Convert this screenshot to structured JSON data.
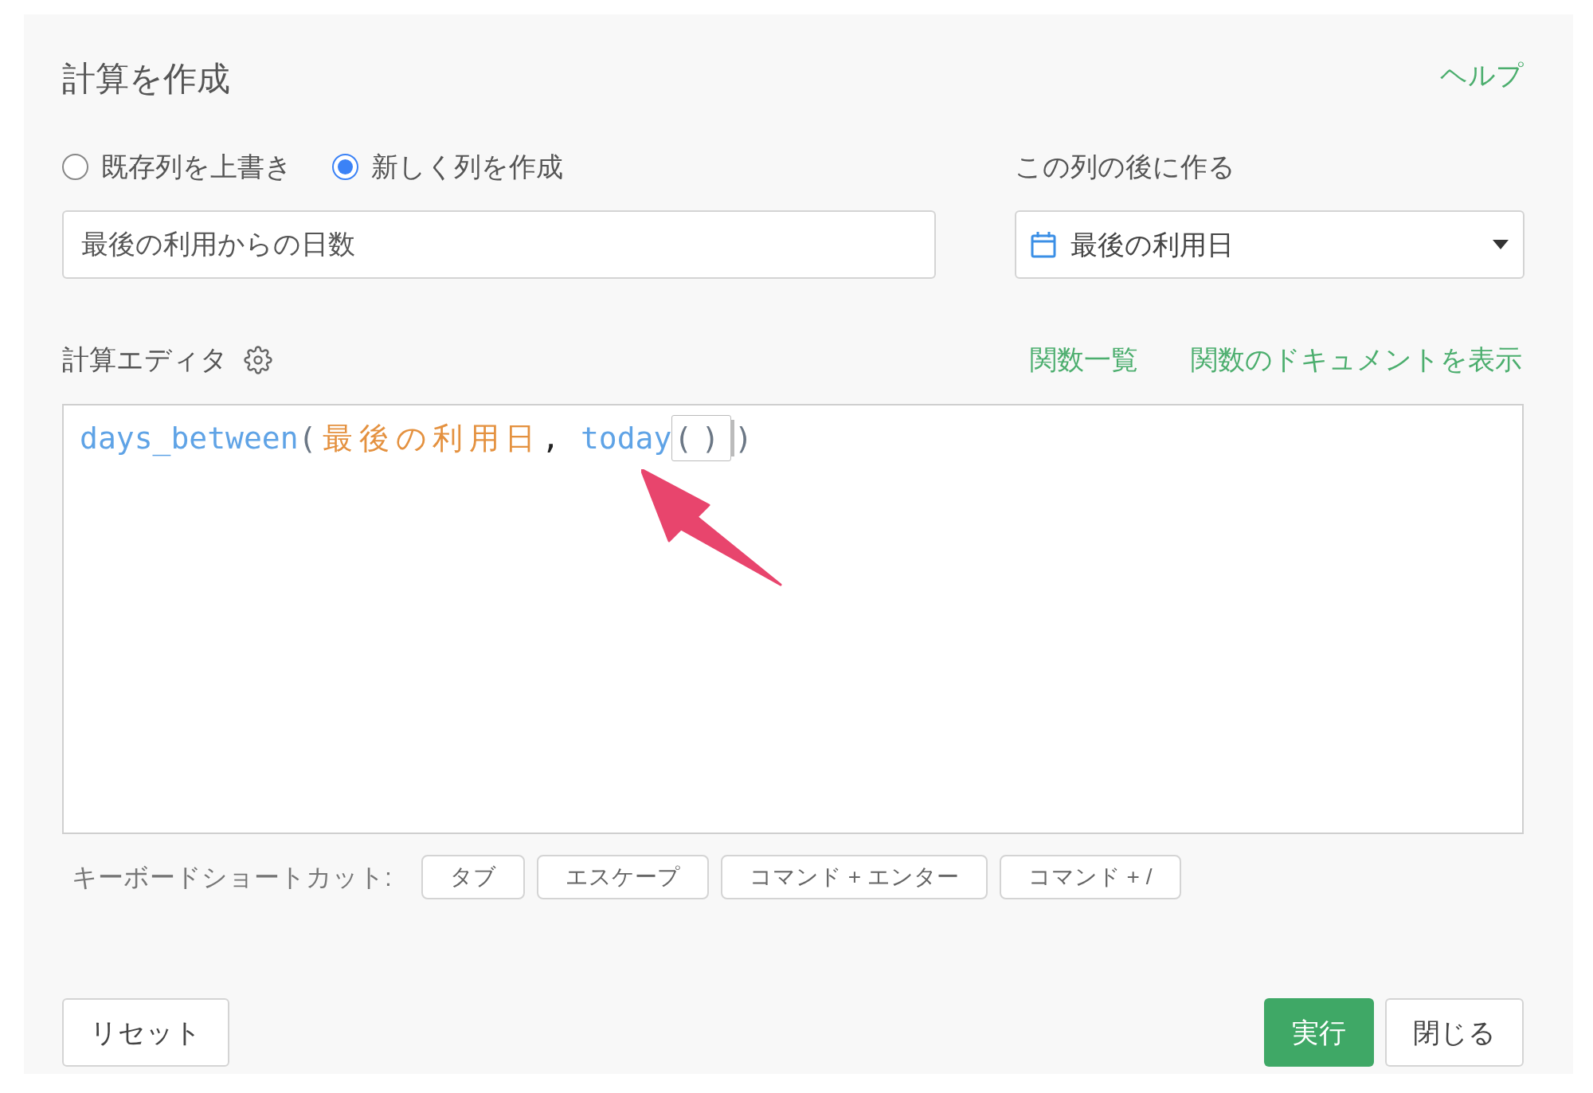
{
  "title": "計算を作成",
  "help_link": "ヘルプ",
  "mode_options": [
    {
      "label": "既存列を上書き",
      "selected": false
    },
    {
      "label": "新しく列を作成",
      "selected": true
    }
  ],
  "new_column": {
    "value": "最後の利用からの日数"
  },
  "position": {
    "label": "この列の後に作る",
    "value": "最後の利用日"
  },
  "editor": {
    "label": "計算エディタ",
    "links": [
      "関数一覧",
      "関数のドキュメントを表示"
    ],
    "tokens": [
      {
        "text": "days_between",
        "kind": "function"
      },
      {
        "text": "(",
        "kind": "paren"
      },
      {
        "text": "最後の利用日",
        "kind": "column"
      },
      {
        "text": ",",
        "kind": "comma"
      },
      {
        "text": "today",
        "kind": "function"
      },
      {
        "text": "()",
        "kind": "matched"
      },
      {
        "text": ")",
        "kind": "paren"
      }
    ]
  },
  "shortcuts": {
    "label": "キーボードショートカット:",
    "keys": [
      "タブ",
      "エスケープ",
      "コマンド + エンター",
      "コマンド + /"
    ]
  },
  "buttons": {
    "reset": "リセット",
    "run": "実行",
    "close": "閉じる"
  }
}
